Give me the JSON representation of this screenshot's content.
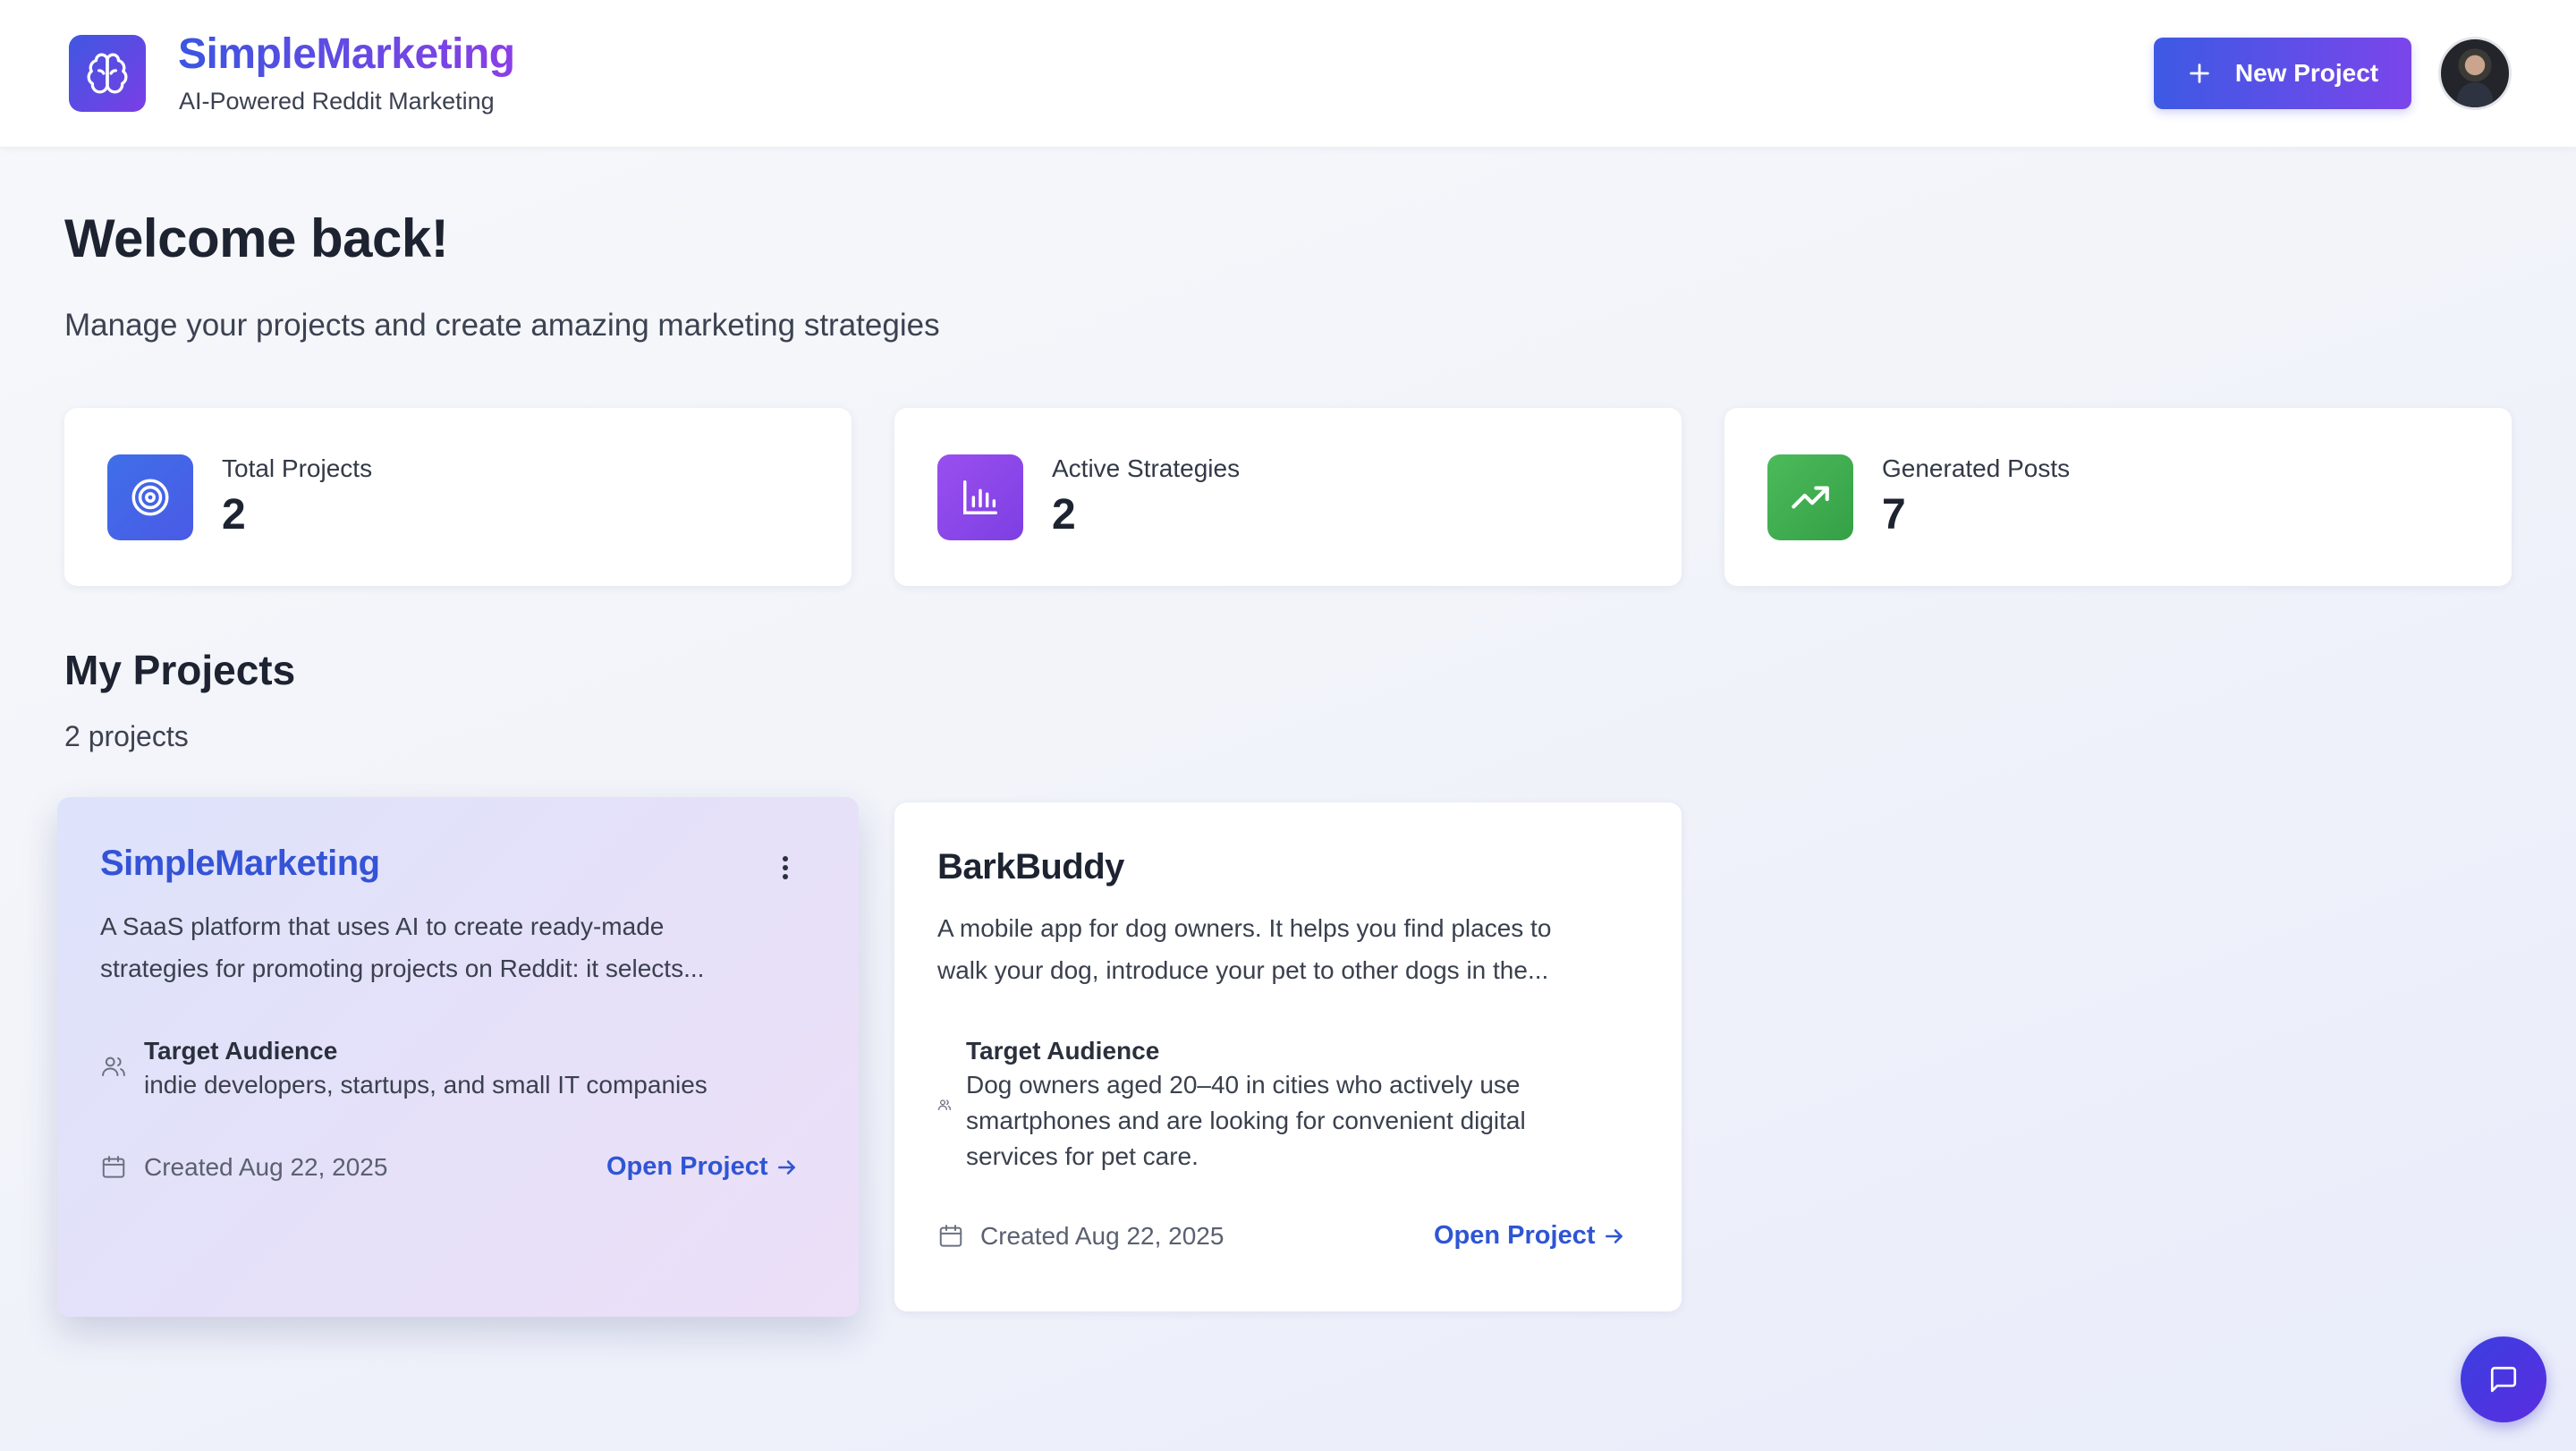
{
  "header": {
    "brand_title": "SimpleMarketing",
    "brand_subtitle": "AI-Powered Reddit Marketing",
    "logo_icon": "brain-icon",
    "new_project_label": "New Project",
    "avatar_icon": "user-avatar"
  },
  "welcome": {
    "title": "Welcome back!",
    "subtitle": "Manage your projects and create amazing marketing strategies"
  },
  "stats": [
    {
      "label": "Total Projects",
      "value": "2",
      "icon": "target-icon",
      "color": "#3f6fe8"
    },
    {
      "label": "Active Strategies",
      "value": "2",
      "icon": "bar-chart-icon",
      "color": "#8b46e6"
    },
    {
      "label": "Generated Posts",
      "value": "7",
      "icon": "trending-up-icon",
      "color": "#3fae4e"
    }
  ],
  "projects_section": {
    "title": "My Projects",
    "count": "2 projects"
  },
  "projects": [
    {
      "name": "SimpleMarketing",
      "description_line1": "A SaaS platform that uses AI to create ready-made",
      "description_line2": "strategies for promoting projects on Reddit: it selects...",
      "target_audience_label": "Target Audience",
      "target_audience": "indie developers, startups, and small IT companies",
      "created": "Created Aug 22, 2025",
      "open_label": "Open Project"
    },
    {
      "name": "BarkBuddy",
      "description_line1": "A mobile app for dog owners. It helps you find places to",
      "description_line2": "walk your dog, introduce your pet to other dogs in the...",
      "target_audience_label": "Target Audience",
      "target_audience_line1": "Dog owners aged 20–40 in cities who actively use",
      "target_audience_line2": "smartphones and are looking for convenient digital",
      "target_audience_line3": "services for pet care.",
      "created": "Created Aug 22, 2025",
      "open_label": "Open Project"
    }
  ],
  "colors": {
    "accent": "#3d5ae4",
    "accent_secondary": "#7b45ea",
    "link": "#2f55d4"
  }
}
